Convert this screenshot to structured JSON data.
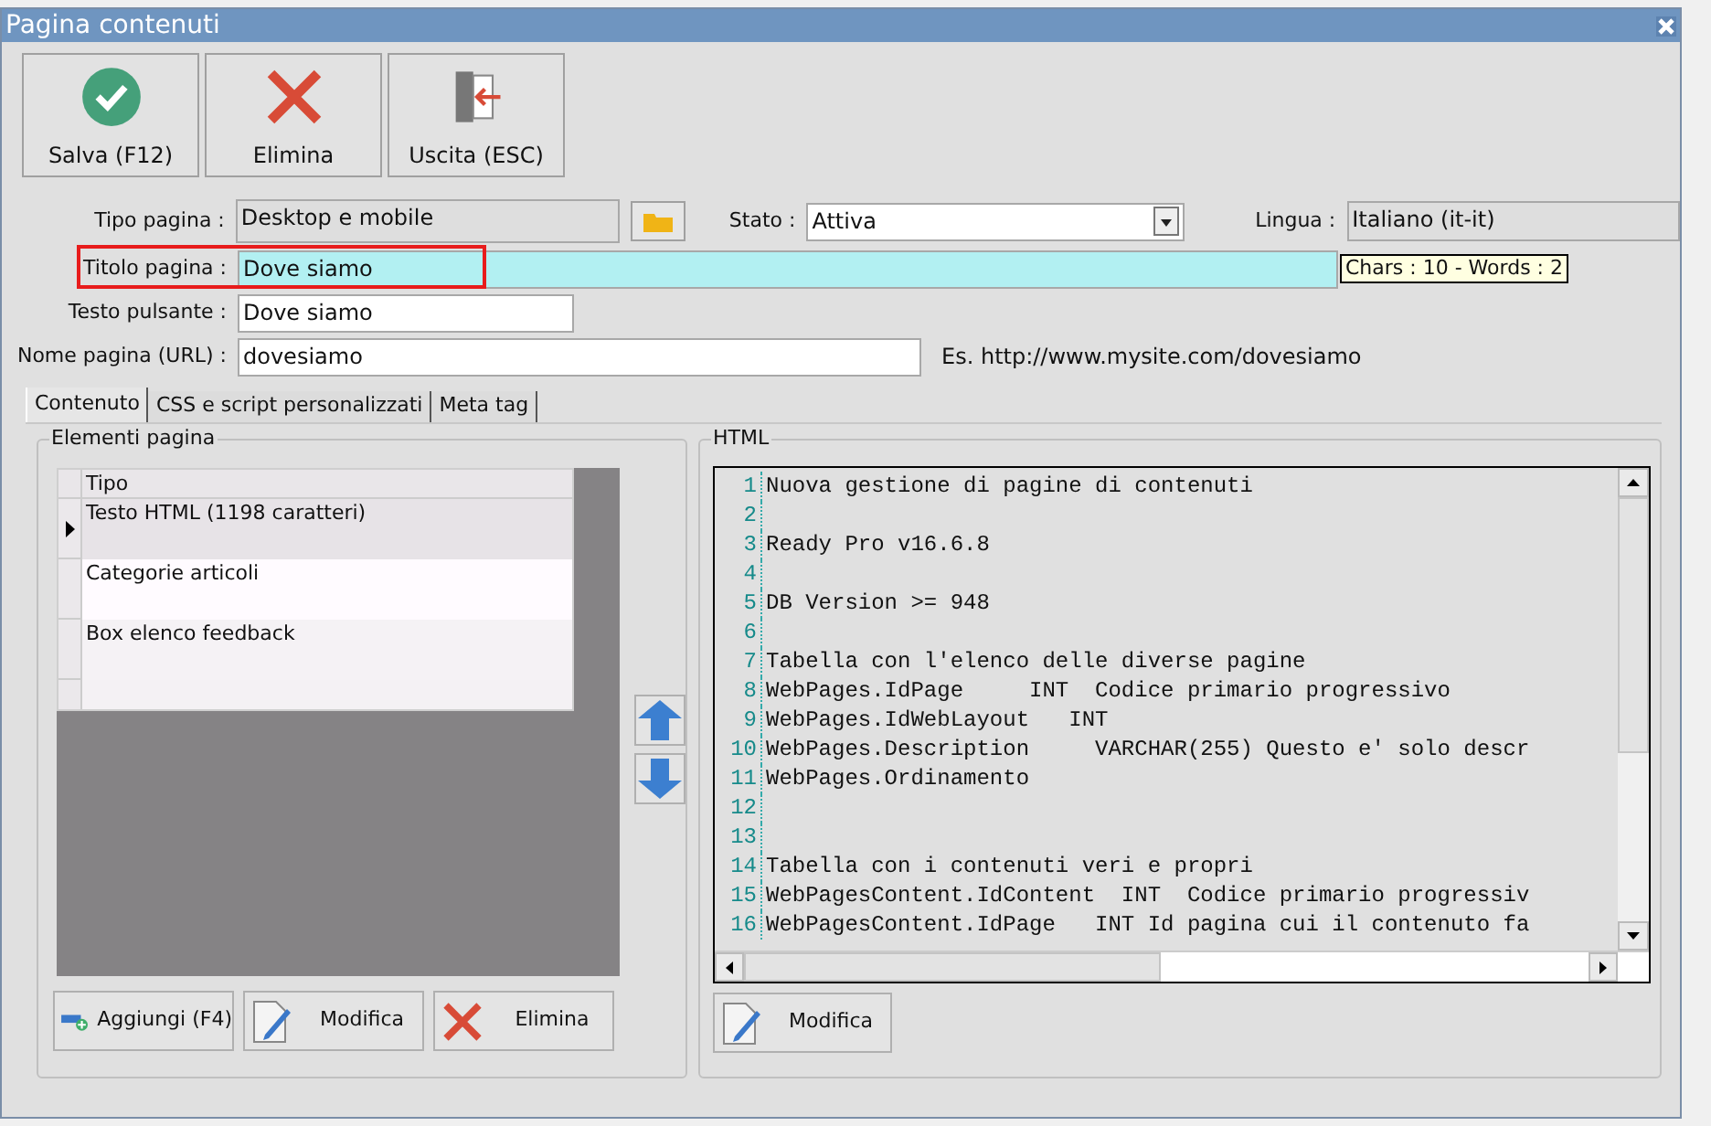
{
  "window": {
    "title": "Pagina contenuti"
  },
  "toolbar": [
    {
      "label": "Salva (F12)",
      "kind": "save"
    },
    {
      "label": "Elimina",
      "kind": "delete"
    },
    {
      "label": "Uscita (ESC)",
      "kind": "exit"
    }
  ],
  "form": {
    "tipo_pagina": {
      "label": "Tipo pagina :",
      "value": "Desktop e mobile"
    },
    "stato": {
      "label": "Stato :",
      "value": "Attiva"
    },
    "lingua": {
      "label": "Lingua :",
      "value": "Italiano (it-it)"
    },
    "titolo_pagina": {
      "label": "Titolo pagina :",
      "value": "Dove siamo",
      "highlighted": true,
      "counter": "Chars : 10 - Words : 2"
    },
    "testo_pulsante": {
      "label": "Testo pulsante :",
      "value": "Dove siamo"
    },
    "nome_pagina": {
      "label": "Nome pagina (URL) :",
      "value": "dovesiamo",
      "hint": "Es. http://www.mysite.com/dovesiamo"
    }
  },
  "tabs": [
    {
      "label": "Contenuto",
      "selected": true
    },
    {
      "label": "CSS e script personalizzati",
      "selected": false
    },
    {
      "label": "Meta tag",
      "selected": false
    }
  ],
  "elements": {
    "title": "Elementi pagina",
    "columns": [
      "Tipo"
    ],
    "rows": [
      {
        "tipo": "Testo HTML (1198 caratteri)",
        "selected": true
      },
      {
        "tipo": "Categorie articoli",
        "selected": false
      },
      {
        "tipo": "Box elenco feedback",
        "selected": false
      }
    ],
    "buttons": [
      {
        "label": "Aggiungi (F4)",
        "kind": "add"
      },
      {
        "label": "Modifica",
        "kind": "edit"
      },
      {
        "label": "Elimina",
        "kind": "delete"
      }
    ]
  },
  "html": {
    "title": "HTML",
    "button": {
      "label": "Modifica",
      "kind": "edit"
    },
    "lines": [
      {
        "number": "1",
        "text": "Nuova gestione di pagine di contenuti"
      },
      {
        "number": "2"
      },
      {
        "number": "3",
        "text": "Ready Pro v16.6.8"
      },
      {
        "number": "4"
      },
      {
        "number": "5",
        "text": "DB Version >= 948"
      },
      {
        "number": "6"
      },
      {
        "number": "7",
        "text": "Tabella con l'elenco delle diverse pagine"
      },
      {
        "number": "8",
        "text": "WebPages.IdPage     INT  Codice primario progressivo"
      },
      {
        "number": "9",
        "text": "WebPages.IdWebLayout   INT"
      },
      {
        "number": "10",
        "text": "WebPages.Description     VARCHAR(255) Questo e' solo descr"
      },
      {
        "number": "11",
        "text": "WebPages.Ordinamento"
      },
      {
        "number": "12"
      },
      {
        "number": "13"
      },
      {
        "number": "14",
        "text": "Tabella con i contenuti veri e propri"
      },
      {
        "number": "15",
        "text": "WebPagesContent.IdContent  INT  Codice primario progressiv"
      },
      {
        "number": "16",
        "text": "WebPagesContent.IdPage   INT Id pagina cui il contenuto fa"
      }
    ]
  }
}
